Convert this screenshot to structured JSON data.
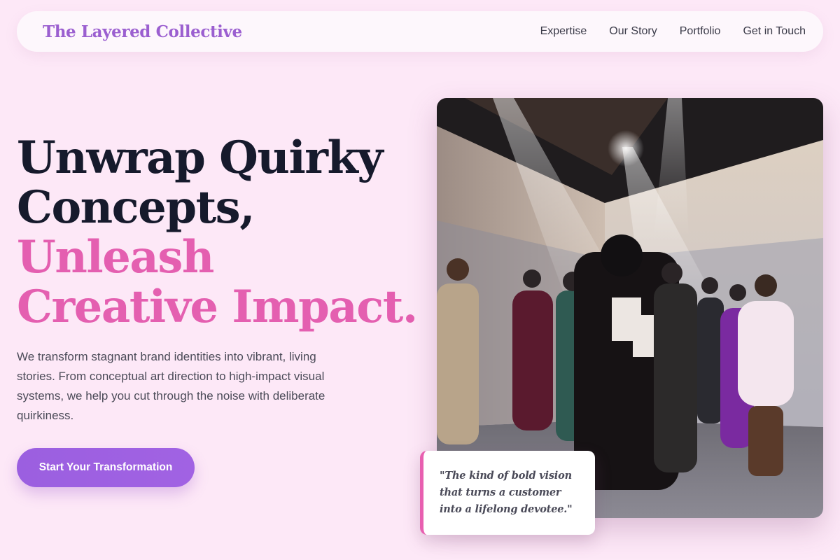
{
  "colors": {
    "background": "#fde8f7",
    "brand": "#9b5fd0",
    "headline_dark": "#161a2c",
    "headline_accent": "#e45fb0",
    "cta": "#9b5fe0",
    "quote_accent": "#e85fb0"
  },
  "header": {
    "brand": "The Layered Collective",
    "nav": [
      {
        "label": "Expertise"
      },
      {
        "label": "Our Story"
      },
      {
        "label": "Portfolio"
      },
      {
        "label": "Get in Touch"
      }
    ]
  },
  "hero": {
    "headline_lines": [
      "Unwrap Quirky",
      "Concepts,",
      "Unleash",
      "Creative Impact."
    ],
    "description": "We transform stagnant brand identities into vibrant, living stories. From conceptual art direction to high-impact visual systems, we help you cut through the noise with deliberate quirkiness.",
    "cta_label": "Start Your Transformation"
  },
  "showcase": {
    "image_icon": "fashion-event-photo",
    "quote": "\"The kind of bold vision that turns a customer into a lifelong devotee.\""
  }
}
